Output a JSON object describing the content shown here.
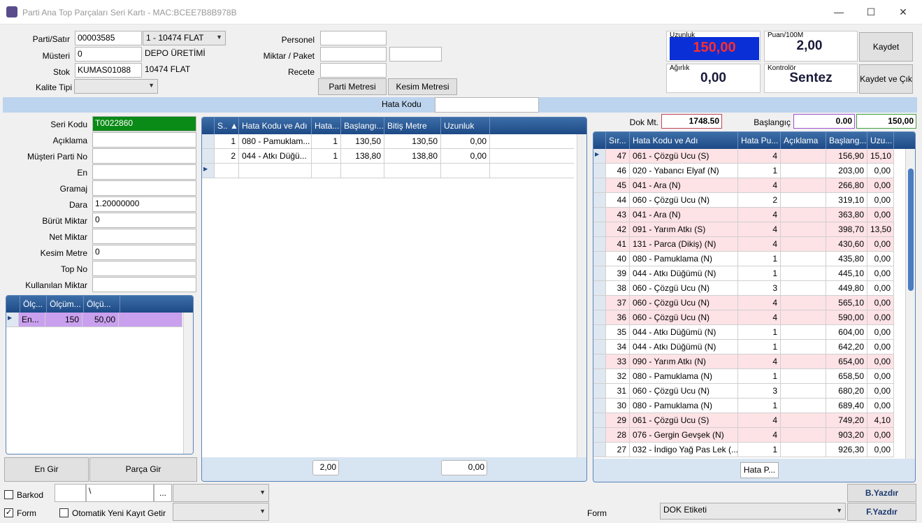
{
  "window": {
    "title": "Parti Ana Top Parçaları Seri Kartı - MAC:BCEE7B8B978B",
    "min": "—",
    "max": "☐",
    "close": "✕"
  },
  "header": {
    "parti_satir_label": "Parti/Satır",
    "parti_no": "00003585",
    "satir_select": "1 - 10474 FLAT",
    "musteri_label": "Müsteri",
    "musteri_value": "0",
    "musteri_name": "DEPO ÜRETİMİ",
    "stok_label": "Stok",
    "stok_value": "KUMAS01088",
    "stok_name": "10474 FLAT",
    "kalite_label": "Kalite Tipi",
    "kalite_value": "",
    "personel_label": "Personel",
    "miktar_paket_label": "Miktar / Paket",
    "recete_label": "Recete",
    "parti_metresi_btn": "Parti Metresi",
    "kesim_metresi_btn": "Kesim Metresi",
    "uzunluk_label": "Uzunluk",
    "uzunluk_value": "150,00",
    "puan_label": "Puan/100M",
    "puan_value": "2,00",
    "agirlik_label": "Ağırlık",
    "agirlik_value": "0,00",
    "kontrolor_label": "Kontrolör",
    "kontrolor_value": "Sentez",
    "kaydet_btn": "Kaydet",
    "kaydet_cik_btn": "Kaydet ve Çık"
  },
  "hata_kodu_label": "Hata Kodu",
  "form_fields": [
    {
      "label": "Seri Kodu",
      "value": "T0022860"
    },
    {
      "label": "Açıklama",
      "value": ""
    },
    {
      "label": "Müşteri Parti No",
      "value": ""
    },
    {
      "label": "En",
      "value": ""
    },
    {
      "label": "Gramaj",
      "value": ""
    },
    {
      "label": "Dara",
      "value": "1.20000000"
    },
    {
      "label": "Bürüt Miktar",
      "value": "0"
    },
    {
      "label": "Net Miktar",
      "value": ""
    },
    {
      "label": "Kesim Metre",
      "value": "0"
    },
    {
      "label": "Top No",
      "value": ""
    },
    {
      "label": "Kullanılan Miktar",
      "value": ""
    }
  ],
  "olcum_grid": {
    "headers": [
      "Ölç...",
      "Ölçüm...",
      "Ölçü..."
    ],
    "rows": [
      [
        "En...",
        "150",
        "50,00"
      ]
    ]
  },
  "en_gir_btn": "En Gir",
  "parca_gir_btn": "Parça Gir",
  "middle_grid": {
    "headers": [
      "S..",
      "Hata Kodu ve Adı",
      "Hata...",
      "Başlangı...",
      "Bitiş Metre",
      "Uzunluk"
    ],
    "rows": [
      [
        "1",
        "080 - Pamuklam...",
        "1",
        "130,50",
        "130,50",
        "0,00"
      ],
      [
        "2",
        "044 - Atkı Düğü...",
        "1",
        "138,80",
        "138,80",
        "0,00"
      ]
    ],
    "footer_puan": "2,00",
    "footer_uzunluk": "0,00"
  },
  "right_top": {
    "dok_label": "Dok Mt.",
    "dok_value": "1748.50",
    "baslangic_label": "Başlangıç",
    "baslangic_value": "0.00",
    "bitis_value": "150,00"
  },
  "right_grid": {
    "headers": [
      "Sır...",
      "Hata Kodu ve Adı",
      "Hata Pu...",
      "Açıklama",
      "Başlang...",
      "Uzu..."
    ],
    "rows": [
      [
        "47",
        "061 - Çözgü Ucu (S)",
        "4",
        "",
        "156,90",
        "15,10",
        true
      ],
      [
        "46",
        "020 - Yabancı Elyaf (N)",
        "1",
        "",
        "203,00",
        "0,00",
        false
      ],
      [
        "45",
        "041 - Ara (N)",
        "4",
        "",
        "266,80",
        "0,00",
        true
      ],
      [
        "44",
        "060 - Çözgü Ucu (N)",
        "2",
        "",
        "319,10",
        "0,00",
        false
      ],
      [
        "43",
        "041 - Ara (N)",
        "4",
        "",
        "363,80",
        "0,00",
        true
      ],
      [
        "42",
        "091 - Yarım Atkı (S)",
        "4",
        "",
        "398,70",
        "13,50",
        true
      ],
      [
        "41",
        "131 - Parca (Dikiş) (N)",
        "4",
        "",
        "430,60",
        "0,00",
        true
      ],
      [
        "40",
        "080 - Pamuklama (N)",
        "1",
        "",
        "435,80",
        "0,00",
        false
      ],
      [
        "39",
        "044 - Atkı Düğümü (N)",
        "1",
        "",
        "445,10",
        "0,00",
        false
      ],
      [
        "38",
        "060 - Çözgü Ucu (N)",
        "3",
        "",
        "449,80",
        "0,00",
        false
      ],
      [
        "37",
        "060 - Çözgü Ucu (N)",
        "4",
        "",
        "565,10",
        "0,00",
        true
      ],
      [
        "36",
        "060 - Çözgü Ucu (N)",
        "4",
        "",
        "590,00",
        "0,00",
        true
      ],
      [
        "35",
        "044 - Atkı Düğümü (N)",
        "1",
        "",
        "604,00",
        "0,00",
        false
      ],
      [
        "34",
        "044 - Atkı Düğümü (N)",
        "1",
        "",
        "642,20",
        "0,00",
        false
      ],
      [
        "33",
        "090 - Yarım Atkı (N)",
        "4",
        "",
        "654,00",
        "0,00",
        true
      ],
      [
        "32",
        "080 - Pamuklama (N)",
        "1",
        "",
        "658,50",
        "0,00",
        false
      ],
      [
        "31",
        "060 - Çözgü Ucu (N)",
        "3",
        "",
        "680,20",
        "0,00",
        false
      ],
      [
        "30",
        "080 - Pamuklama (N)",
        "1",
        "",
        "689,40",
        "0,00",
        false
      ],
      [
        "29",
        "061 - Çözgü Ucu (S)",
        "4",
        "",
        "749,20",
        "4,10",
        true
      ],
      [
        "28",
        "076 - Gergin Gevşek (N)",
        "4",
        "",
        "903,20",
        "0,00",
        true
      ],
      [
        "27",
        "032 - İndigo Yağ Pas Lek (...",
        "1",
        "",
        "926,30",
        "0,00",
        false
      ]
    ],
    "hata_btn": "Hata P..."
  },
  "bottom": {
    "barkod_label": "Barkod",
    "path_value": "\\",
    "browse_btn": "...",
    "form_label": "Form",
    "otomatik_label": "Otomatik Yeni Kayıt Getir",
    "form_right_label": "Form",
    "etiket_value": "DOK Etiketi",
    "b_yazdir": "B.Yazdır",
    "f_yazdir": "F.Yazdır"
  },
  "colors": {
    "pink": "#fde2e6",
    "uzunluk_bg": "#0b2fd6",
    "uzunluk_text": "#ff2d2d",
    "seri_bg": "#0a8a16",
    "olcum_row": "#c9a0ee"
  }
}
